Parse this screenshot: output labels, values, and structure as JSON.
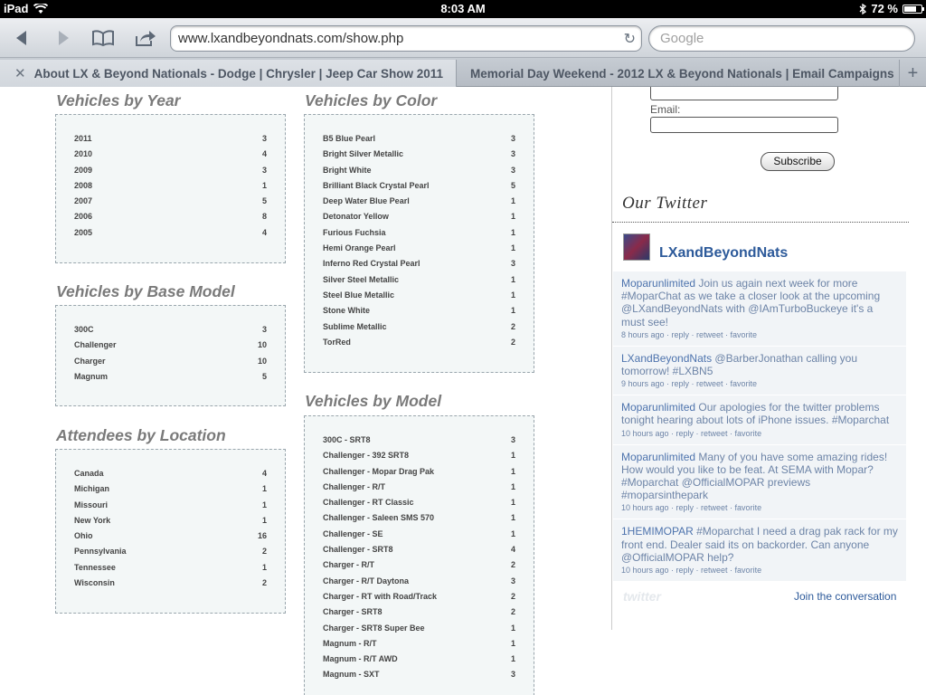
{
  "status_bar": {
    "device": "iPad",
    "time": "8:03 AM",
    "battery": "72 %",
    "battery_level": 0.72,
    "icons": [
      "wifi-icon",
      "bluetooth-icon",
      "battery-icon"
    ]
  },
  "browser": {
    "url": "www.lxandbeyondnats.com/show.php",
    "search_placeholder": "Google",
    "tabs": [
      {
        "title": "About LX & Beyond Nationals - Dodge | Chrysler | Jeep Car Show 2011",
        "close": "✕"
      },
      {
        "title": "Memorial Day Weekend - 2012 LX & Beyond Nationals | Email Campaigns"
      }
    ],
    "add_tab": "+"
  },
  "sections": {
    "year": {
      "title": "Vehicles by Year",
      "rows": [
        {
          "label": "2011",
          "count": "3"
        },
        {
          "label": "2010",
          "count": "4"
        },
        {
          "label": "2009",
          "count": "3"
        },
        {
          "label": "2008",
          "count": "1"
        },
        {
          "label": "2007",
          "count": "5"
        },
        {
          "label": "2006",
          "count": "8"
        },
        {
          "label": "2005",
          "count": "4"
        }
      ]
    },
    "base_model": {
      "title": "Vehicles by Base Model",
      "rows": [
        {
          "label": "300C",
          "count": "3"
        },
        {
          "label": "Challenger",
          "count": "10"
        },
        {
          "label": "Charger",
          "count": "10"
        },
        {
          "label": "Magnum",
          "count": "5"
        }
      ]
    },
    "location": {
      "title": "Attendees by Location",
      "rows": [
        {
          "label": "Canada",
          "count": "4"
        },
        {
          "label": "Michigan",
          "count": "1"
        },
        {
          "label": "Missouri",
          "count": "1"
        },
        {
          "label": "New York",
          "count": "1"
        },
        {
          "label": "Ohio",
          "count": "16"
        },
        {
          "label": "Pennsylvania",
          "count": "2"
        },
        {
          "label": "Tennessee",
          "count": "1"
        },
        {
          "label": "Wisconsin",
          "count": "2"
        }
      ]
    },
    "color": {
      "title": "Vehicles by Color",
      "rows": [
        {
          "label": "B5 Blue Pearl",
          "count": "3"
        },
        {
          "label": "Bright Silver Metallic",
          "count": "3"
        },
        {
          "label": "Bright White",
          "count": "3"
        },
        {
          "label": "Brilliant Black Crystal Pearl",
          "count": "5"
        },
        {
          "label": "Deep Water Blue Pearl",
          "count": "1"
        },
        {
          "label": "Detonator Yellow",
          "count": "1"
        },
        {
          "label": "Furious Fuchsia",
          "count": "1"
        },
        {
          "label": "Hemi Orange Pearl",
          "count": "1"
        },
        {
          "label": "Inferno Red Crystal Pearl",
          "count": "3"
        },
        {
          "label": "Silver Steel Metallic",
          "count": "1"
        },
        {
          "label": "Steel Blue Metallic",
          "count": "1"
        },
        {
          "label": "Stone White",
          "count": "1"
        },
        {
          "label": "Sublime Metallic",
          "count": "2"
        },
        {
          "label": "TorRed",
          "count": "2"
        }
      ]
    },
    "model": {
      "title": "Vehicles by Model",
      "rows": [
        {
          "label": "300C - SRT8",
          "count": "3"
        },
        {
          "label": "Challenger - 392 SRT8",
          "count": "1"
        },
        {
          "label": "Challenger - Mopar Drag Pak",
          "count": "1"
        },
        {
          "label": "Challenger - R/T",
          "count": "1"
        },
        {
          "label": "Challenger - RT Classic",
          "count": "1"
        },
        {
          "label": "Challenger - Saleen SMS 570",
          "count": "1"
        },
        {
          "label": "Challenger - SE",
          "count": "1"
        },
        {
          "label": "Challenger - SRT8",
          "count": "4"
        },
        {
          "label": "Charger - R/T",
          "count": "2"
        },
        {
          "label": "Charger - R/T Daytona",
          "count": "3"
        },
        {
          "label": "Charger - RT with Road/Track",
          "count": "2"
        },
        {
          "label": "Charger - SRT8",
          "count": "2"
        },
        {
          "label": "Charger - SRT8 Super Bee",
          "count": "1"
        },
        {
          "label": "Magnum - R/T",
          "count": "1"
        },
        {
          "label": "Magnum - R/T AWD",
          "count": "1"
        },
        {
          "label": "Magnum - SXT",
          "count": "3"
        }
      ]
    }
  },
  "sidebar": {
    "email_label": "Email:",
    "subscribe_label": "Subscribe",
    "twitter_heading": "Our Twitter",
    "twitter_user": "LXandBeyondNats",
    "tweets": [
      {
        "who": "Moparunlimited",
        "text": " Join us again next week for more #MoparChat as we take a closer look at the upcoming @LXandBeyondNats with @IAmTurboBuckeye it's a must see!",
        "meta": "8 hours ago · reply · retweet · favorite"
      },
      {
        "who": "LXandBeyondNats",
        "text": " @BarberJonathan calling you tomorrow! #LXBN5",
        "meta": "9 hours ago · reply · retweet · favorite"
      },
      {
        "who": "Moparunlimited",
        "text": " Our apologies for the twitter problems tonight hearing about lots of iPhone issues. #Moparchat",
        "meta": "10 hours ago · reply · retweet · favorite"
      },
      {
        "who": "Moparunlimited",
        "text": " Many of you have some amazing rides! How would you like to be feat. At SEMA with Mopar? #Moparchat @OfficialMOPAR previews #moparsinthepark",
        "meta": "10 hours ago · reply · retweet · favorite"
      },
      {
        "who": "1HEMIMOPAR",
        "text": " #Moparchat I need a drag pak rack for my front end. Dealer said its on backorder. Can anyone @OfficialMOPAR help?",
        "meta": "10 hours ago · reply · retweet · favorite"
      }
    ],
    "twitter_logo": "twitter",
    "join_label": "Join the conversation"
  },
  "colors": {
    "link_blue": "#2d5a9a",
    "box_border": "#9aa6ad",
    "heading_gray": "#7a7a7a"
  }
}
